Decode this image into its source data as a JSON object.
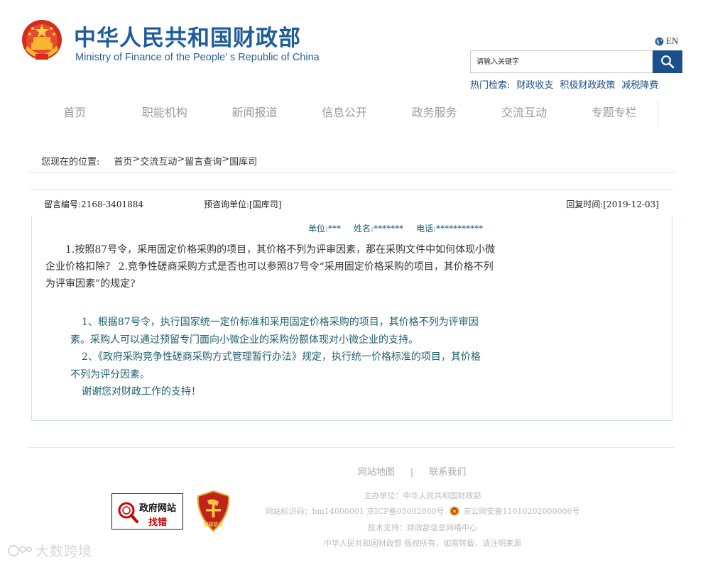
{
  "header": {
    "title_cn": "中华人民共和国财政部",
    "title_en": "Ministry of Finance of the People' s Republic of China",
    "lang_label": "EN",
    "search": {
      "placeholder": "请输入关键字"
    },
    "hot": {
      "label": "热门检索:",
      "links": [
        "财政收支",
        "积极财政政策",
        "减税降费"
      ]
    }
  },
  "nav": {
    "items": [
      "首页",
      "职能机构",
      "新闻报道",
      "信息公开",
      "政务服务",
      "交流互动",
      "专题专栏"
    ]
  },
  "breadcrumb": {
    "prefix": "您现在的位置:",
    "items": [
      "首页",
      ">",
      "交流互动",
      ">",
      "留言查询",
      ">",
      "国库司"
    ]
  },
  "message": {
    "id": "留言编号:2168-3401884",
    "unit": "预咨询单位:[国库司]",
    "reply_time": "回复时间:[2019-12-03]",
    "contact": {
      "unit": "单位:***",
      "name": "姓名:*******",
      "phone": "电话:***********"
    },
    "question": "1.按照87号令，采用固定价格采购的项目，其价格不列为评审因素，那在采购文件中如何体现小微企业价格扣除？ 2.竞争性磋商采购方式是否也可以参照87号令“采用固定价格采购的项目，其价格不列为评审因素”的规定?",
    "reply": [
      "1、根据87号令，执行国家统一定价标准和采用固定价格采购的项目，其价格不列为评审因素。采购人可以通过预留专门面向小微企业的采购份额体现对小微企业的支持。",
      "2、《政府采购竞争性磋商采购方式管理暂行办法》规定，执行统一价格标准的项目，其价格不列为评分因素。",
      "谢谢您对财政工作的支持！"
    ]
  },
  "footer": {
    "links": [
      "网站地图",
      "|",
      "联系我们"
    ],
    "host": "主办单位：中华人民共和国财政部",
    "site_id": "网站标识码：bm14000001  京ICP备05002860号",
    "police": "京公网安备11010202000006号",
    "tech": "技术支持：财政部信息网络中心",
    "copyright": "中华人民共和国财政部  版权所有，如需转载，请注明来源",
    "gov_badge": {
      "line1": "政府网站",
      "line2": "找错"
    },
    "party_badge": {
      "text": "党政机关"
    }
  },
  "watermark": "大数跨境",
  "colors": {
    "title_blue": "#1d5c9a",
    "search_button": "#1b4f8c",
    "reply_teal": "#1e5f6e",
    "hot_link": "#1d4f86"
  }
}
